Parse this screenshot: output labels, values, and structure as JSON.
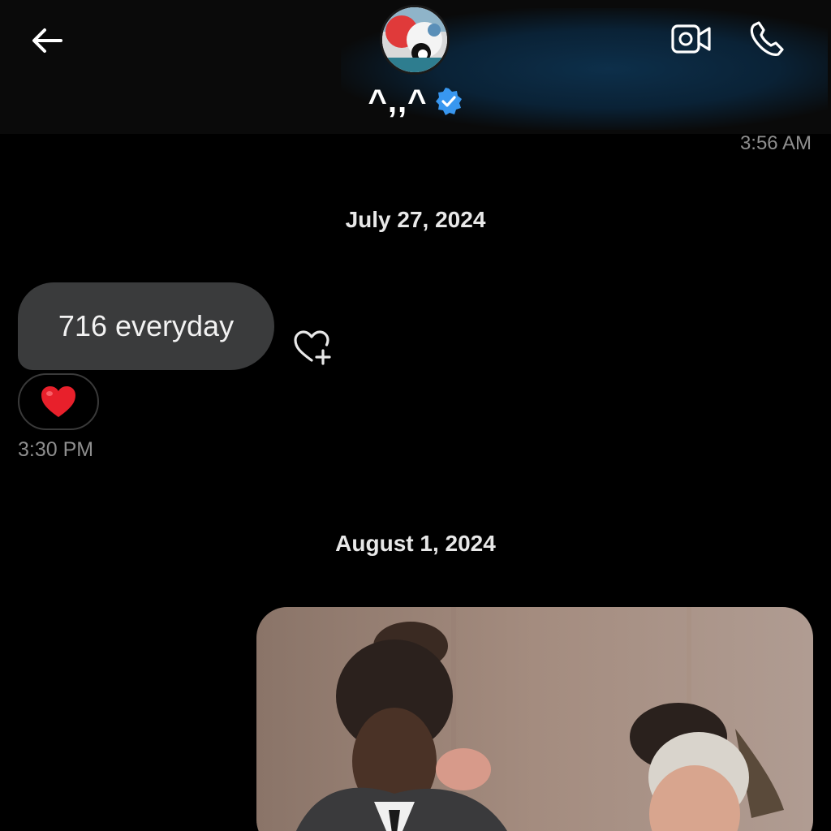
{
  "header": {
    "contact_name": "^,,^",
    "top_time": "3:56 AM",
    "accent_color": "#3897f0",
    "icons": [
      "arrow-left-icon",
      "verified-badge-icon",
      "video-camera-icon",
      "phone-icon"
    ]
  },
  "thread": {
    "date_1": "July 27, 2024",
    "message_1": {
      "text": "716 everyday",
      "reaction_emoji": "❤️",
      "time": "3:30 PM"
    },
    "date_2": "August 1, 2024"
  },
  "colors": {
    "background": "#000000",
    "bubble": "#3a3b3c",
    "muted_text": "#8e8e8e"
  }
}
